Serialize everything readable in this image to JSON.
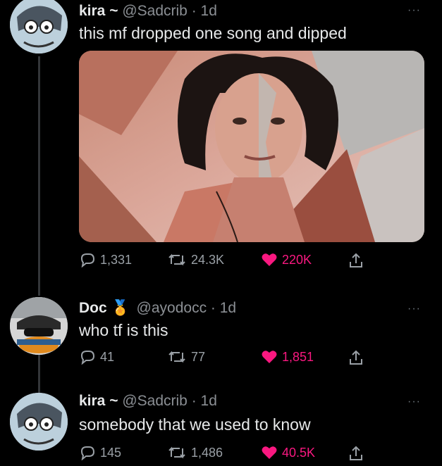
{
  "tweets": [
    {
      "name": "kira",
      "name_emoji": "~",
      "handle": "@Sadcrib",
      "time": "· 1d",
      "text": "this mf dropped one song and dipped",
      "more": "···",
      "replies": "1,331",
      "retweets": "24.3K",
      "likes": "220K"
    },
    {
      "name": "Doc",
      "name_emoji": "🏅",
      "handle": "@ayodocc",
      "time": "· 1d",
      "text": "who tf is this",
      "more": "···",
      "replies": "41",
      "retweets": "77",
      "likes": "1,851"
    },
    {
      "name": "kira",
      "name_emoji": "~",
      "handle": "@Sadcrib",
      "time": "· 1d",
      "text": "somebody that we used to know",
      "more": "···",
      "replies": "145",
      "retweets": "1,486",
      "likes": "40.5K"
    }
  ],
  "colors": {
    "like": "#f91880",
    "muted": "#9aa0a6",
    "background": "#000000"
  },
  "icons": [
    "reply-icon",
    "retweet-icon",
    "heart-icon",
    "share-icon",
    "more-icon"
  ]
}
